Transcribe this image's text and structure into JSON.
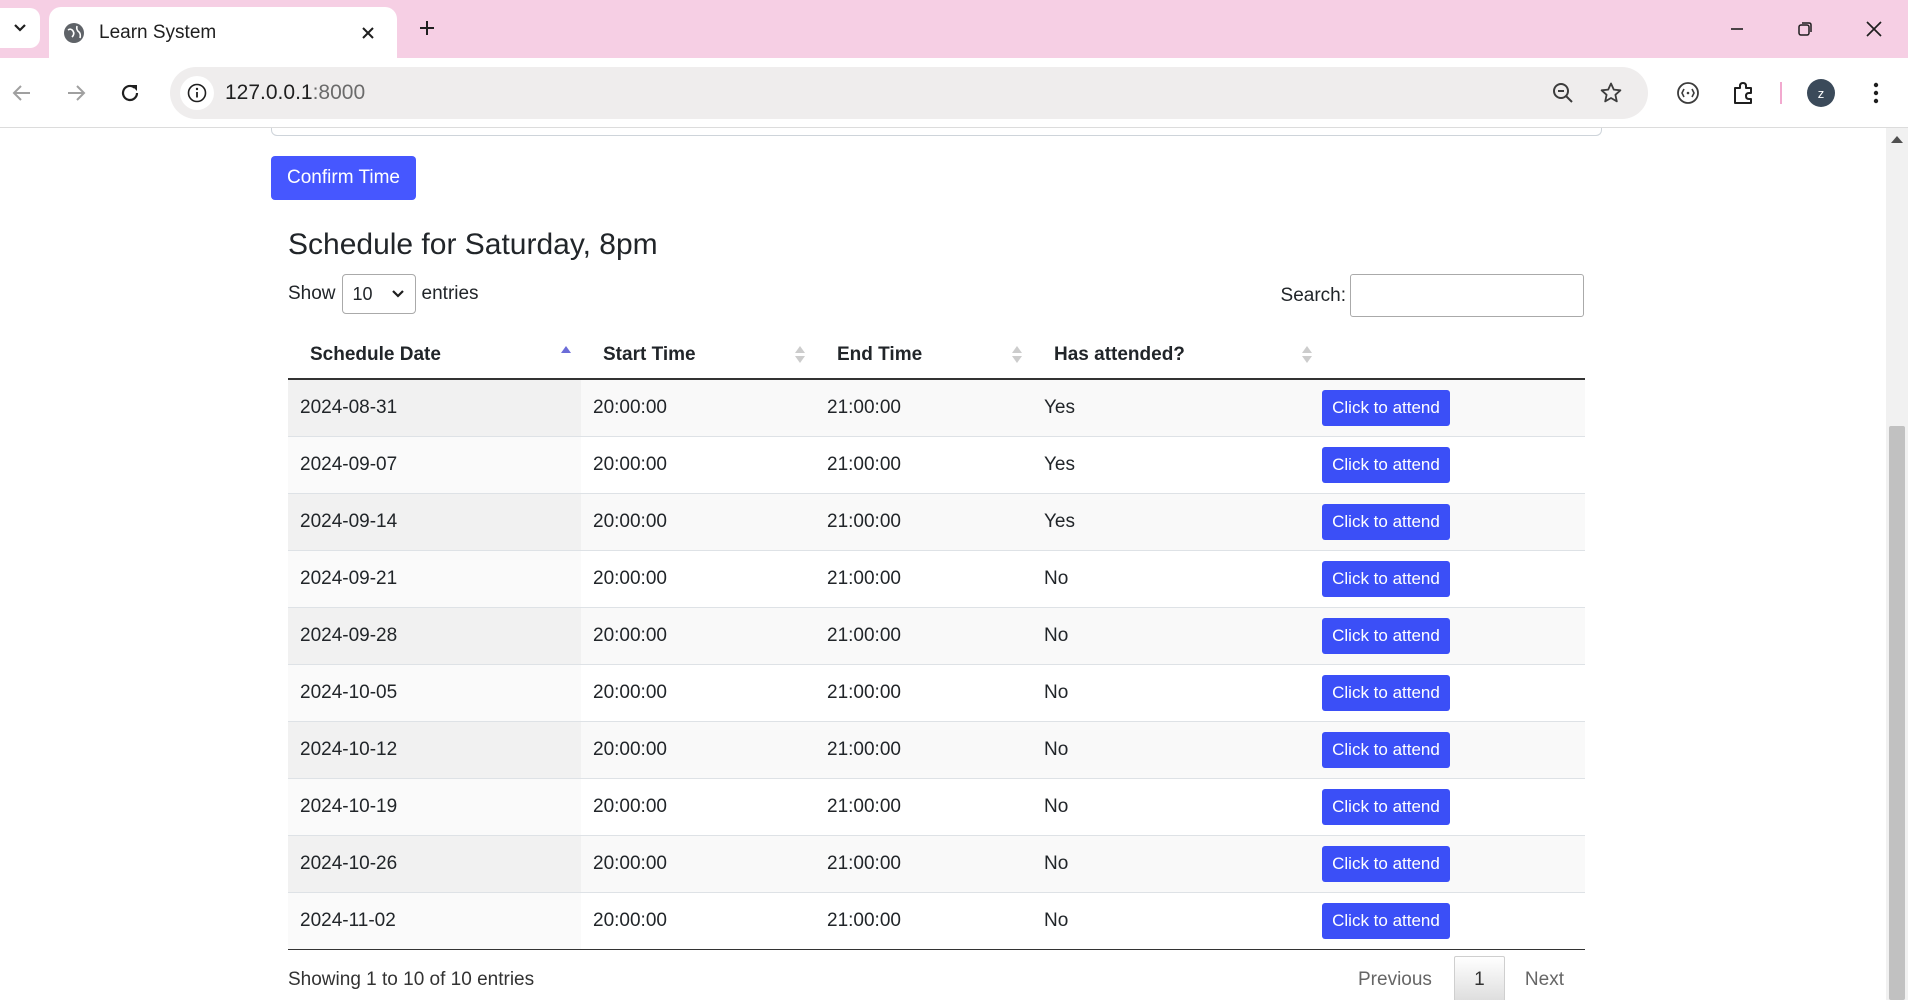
{
  "browser": {
    "tab_title": "Learn System",
    "url_host": "127.0.0.1",
    "url_port": ":8000",
    "profile_initial": "z"
  },
  "page": {
    "confirm_label": "Confirm Time",
    "schedule_title": "Schedule for Saturday, 8pm",
    "show_label": "Show",
    "entries_select_value": "10",
    "entries_label": "entries",
    "search_label": "Search:",
    "columns": [
      "Schedule Date",
      "Start Time",
      "End Time",
      "Has attended?"
    ],
    "rows": [
      {
        "date": "2024-08-31",
        "start": "20:00:00",
        "end": "21:00:00",
        "attended": "Yes",
        "action": "Click to attend"
      },
      {
        "date": "2024-09-07",
        "start": "20:00:00",
        "end": "21:00:00",
        "attended": "Yes",
        "action": "Click to attend"
      },
      {
        "date": "2024-09-14",
        "start": "20:00:00",
        "end": "21:00:00",
        "attended": "Yes",
        "action": "Click to attend"
      },
      {
        "date": "2024-09-21",
        "start": "20:00:00",
        "end": "21:00:00",
        "attended": "No",
        "action": "Click to attend"
      },
      {
        "date": "2024-09-28",
        "start": "20:00:00",
        "end": "21:00:00",
        "attended": "No",
        "action": "Click to attend"
      },
      {
        "date": "2024-10-05",
        "start": "20:00:00",
        "end": "21:00:00",
        "attended": "No",
        "action": "Click to attend"
      },
      {
        "date": "2024-10-12",
        "start": "20:00:00",
        "end": "21:00:00",
        "attended": "No",
        "action": "Click to attend"
      },
      {
        "date": "2024-10-19",
        "start": "20:00:00",
        "end": "21:00:00",
        "attended": "No",
        "action": "Click to attend"
      },
      {
        "date": "2024-10-26",
        "start": "20:00:00",
        "end": "21:00:00",
        "attended": "No",
        "action": "Click to attend"
      },
      {
        "date": "2024-11-02",
        "start": "20:00:00",
        "end": "21:00:00",
        "attended": "No",
        "action": "Click to attend"
      }
    ],
    "info_text": "Showing 1 to 10 of 10 entries",
    "pagination": {
      "previous": "Previous",
      "current": "1",
      "next": "Next"
    }
  },
  "colors": {
    "tab_strip": "#f6cfe4",
    "primary_button": "#4657ff",
    "attend_button": "#3b4ff7"
  },
  "icons": [
    "tab-search-icon",
    "globe-icon",
    "close-icon",
    "plus-icon",
    "minimize-icon",
    "restore-icon",
    "back-icon",
    "forward-icon",
    "reload-icon",
    "info-icon",
    "zoom-icon",
    "star-icon",
    "extension-icon",
    "puzzle-icon",
    "menu-icon"
  ]
}
